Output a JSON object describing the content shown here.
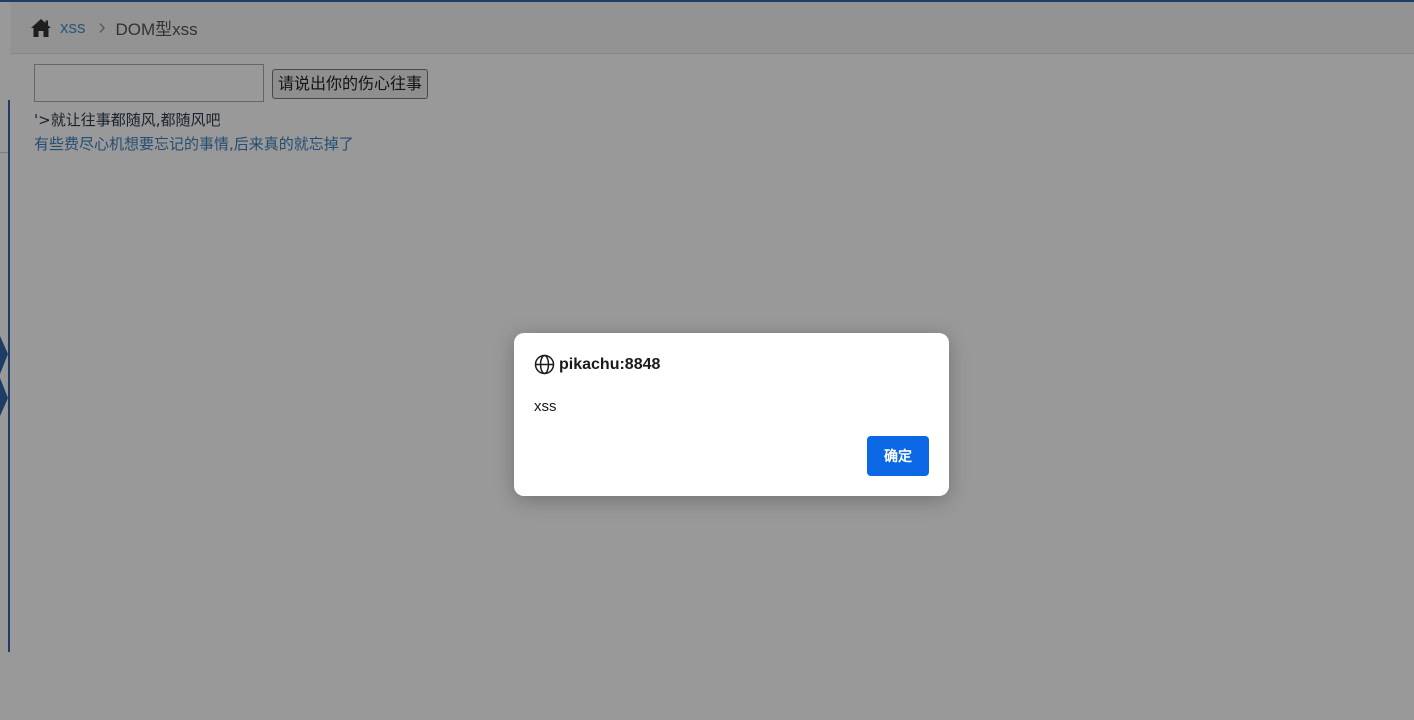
{
  "breadcrumb": {
    "home_icon": "home-icon",
    "section_link": "xss",
    "separator_icon": "chevron-right-icon",
    "current": "DOM型xss"
  },
  "form": {
    "input_value": "",
    "submit_label": "请说出你的伤心往事"
  },
  "output": {
    "echo_text": "'>就让往事都随风,都随风吧",
    "result_link": "有些费尽心机想要忘记的事情,后来真的就忘掉了"
  },
  "alert": {
    "origin_icon": "globe-icon",
    "origin": "pikachu:8848",
    "message": "xss",
    "ok_label": "确定"
  },
  "colors": {
    "accent": "#2f66a8",
    "link": "#3f80bf",
    "ok_button": "#0b67e3"
  }
}
